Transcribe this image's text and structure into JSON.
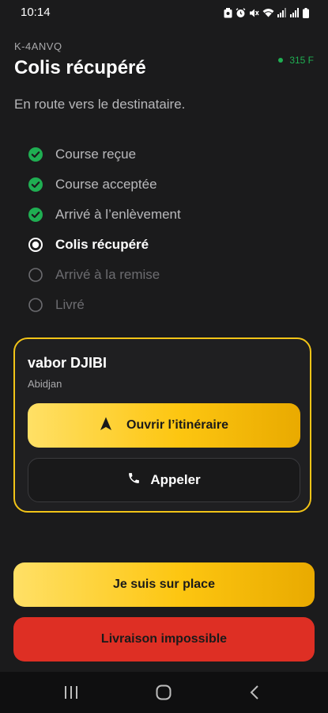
{
  "status_bar": {
    "time": "10:14",
    "icons": [
      "image-icon",
      "alarm-icon",
      "mute-icon",
      "wifi-icon",
      "signal-icon",
      "signal-icon",
      "battery-icon"
    ]
  },
  "header": {
    "reference": "K-4ANVQ",
    "title": "Colis récupéré",
    "subtitle": "En route vers le destinataire.",
    "price": "315 F",
    "price_color": "#1fae52"
  },
  "steps": [
    {
      "label": "Course reçue",
      "state": "done"
    },
    {
      "label": "Course acceptée",
      "state": "done"
    },
    {
      "label": "Arrivé à l’enlèvement",
      "state": "done"
    },
    {
      "label": "Colis récupéré",
      "state": "current"
    },
    {
      "label": "Arrivé à la remise",
      "state": "pending"
    },
    {
      "label": "Livré",
      "state": "pending"
    }
  ],
  "contact_card": {
    "name": "vabor DJIBI",
    "city": "Abidjan",
    "route_button_label": "Ouvrir l’itinéraire",
    "call_button_label": "Appeler",
    "border_color": "#f2c417"
  },
  "actions": {
    "on_site_label": "Je suis sur place",
    "impossible_label": "Livraison impossible",
    "accent_color": "#fdc611",
    "danger_color": "#de2f24"
  },
  "nav_bar": {
    "buttons": [
      "recent-apps-icon",
      "home-icon",
      "back-icon"
    ]
  }
}
